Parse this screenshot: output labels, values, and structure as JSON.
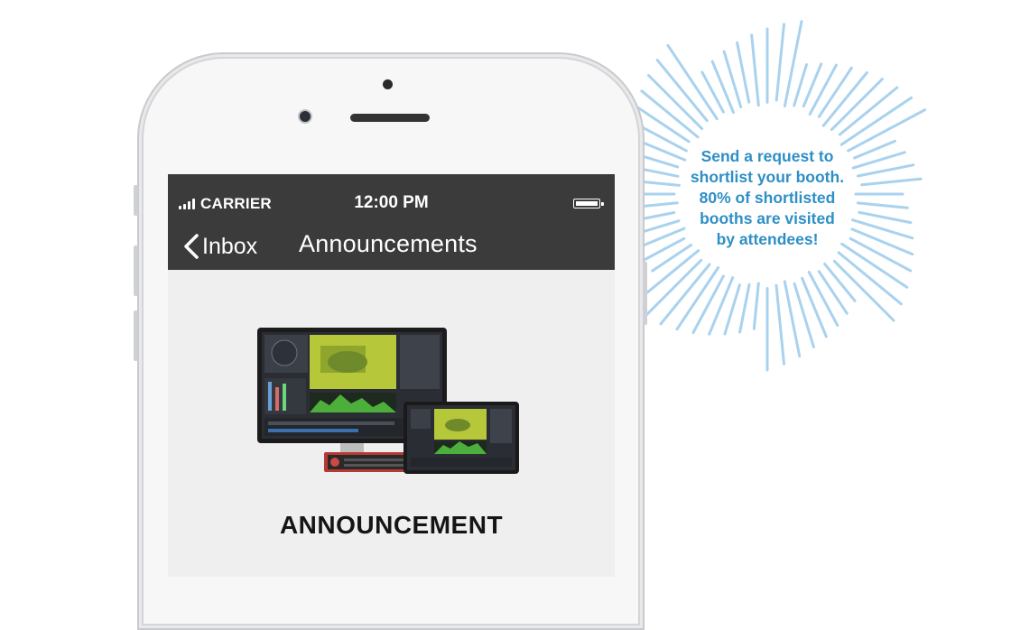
{
  "status_bar": {
    "carrier": "CARRIER",
    "time": "12:00 PM"
  },
  "nav_bar": {
    "back_label": "Inbox",
    "title": "Announcements"
  },
  "content": {
    "heading": "ANNOUNCEMENT"
  },
  "callout": {
    "lines": [
      "Send a request to",
      "shortlist your booth.",
      "80% of shortlisted",
      "booths are visited",
      "by attendees!"
    ]
  },
  "colors": {
    "nav_bg": "#3b3b3b",
    "screen_bg": "#efefef",
    "callout_text": "#2e8fc6",
    "burst_rays": "#a9d2ee"
  },
  "icons": [
    "signal-icon",
    "battery-icon",
    "back-chevron-icon"
  ]
}
